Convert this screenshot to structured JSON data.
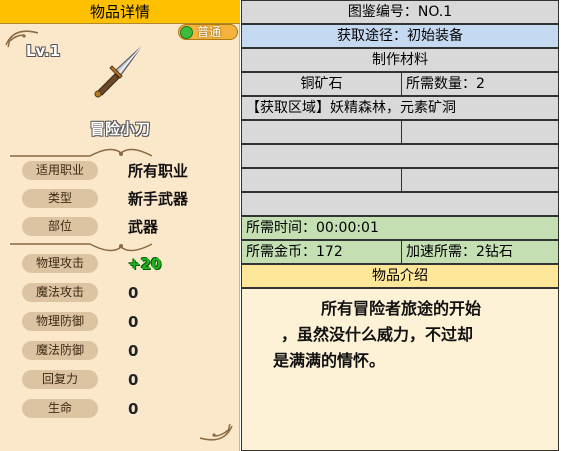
{
  "left_panel": {
    "header": "物品详情",
    "level": "Lv.1",
    "quality": "普通",
    "item_name": "冒险小刀",
    "attributes": [
      {
        "label": "适用职业",
        "value": "所有职业"
      },
      {
        "label": "类型",
        "value": "新手武器"
      },
      {
        "label": "部位",
        "value": "武器"
      }
    ],
    "stats": [
      {
        "label": "物理攻击",
        "value": "+20"
      },
      {
        "label": "魔法攻击",
        "value": "0"
      },
      {
        "label": "物理防御",
        "value": "0"
      },
      {
        "label": "魔法防御",
        "value": "0"
      },
      {
        "label": "回复力",
        "value": "0"
      },
      {
        "label": "生命",
        "value": "0"
      }
    ]
  },
  "right_panel": {
    "catalog_no": "图鉴编号：NO.1",
    "source": "获取途径：初始装备",
    "materials_header": "制作材料",
    "material_name": "铜矿石",
    "material_qty": "所需数量：2",
    "region": "【获取区域】妖精森林，元素矿洞",
    "time_required": "所需时间：00:00:01",
    "gold_required": "所需金币：172",
    "speedup_cost": "加速所需：2钻石",
    "intro_header": "物品介绍",
    "intro_text_line1": "所有冒险者旅途的开始",
    "intro_text_line2": "，虽然没什么威力，不过却",
    "intro_text_line3": "是满满的情怀。"
  },
  "colors": {
    "header_yellow": "#ffc000",
    "parchment": "#fbe7c9",
    "blue_row": "#c5d9f1",
    "green_row": "#c4e0b3",
    "gray_row": "#d9d9d9",
    "quality_green": "#3dbb3d",
    "stat_green": "#1fb31f"
  },
  "icons": [
    "quality-badge-icon",
    "dagger-icon",
    "ornament-icon"
  ]
}
